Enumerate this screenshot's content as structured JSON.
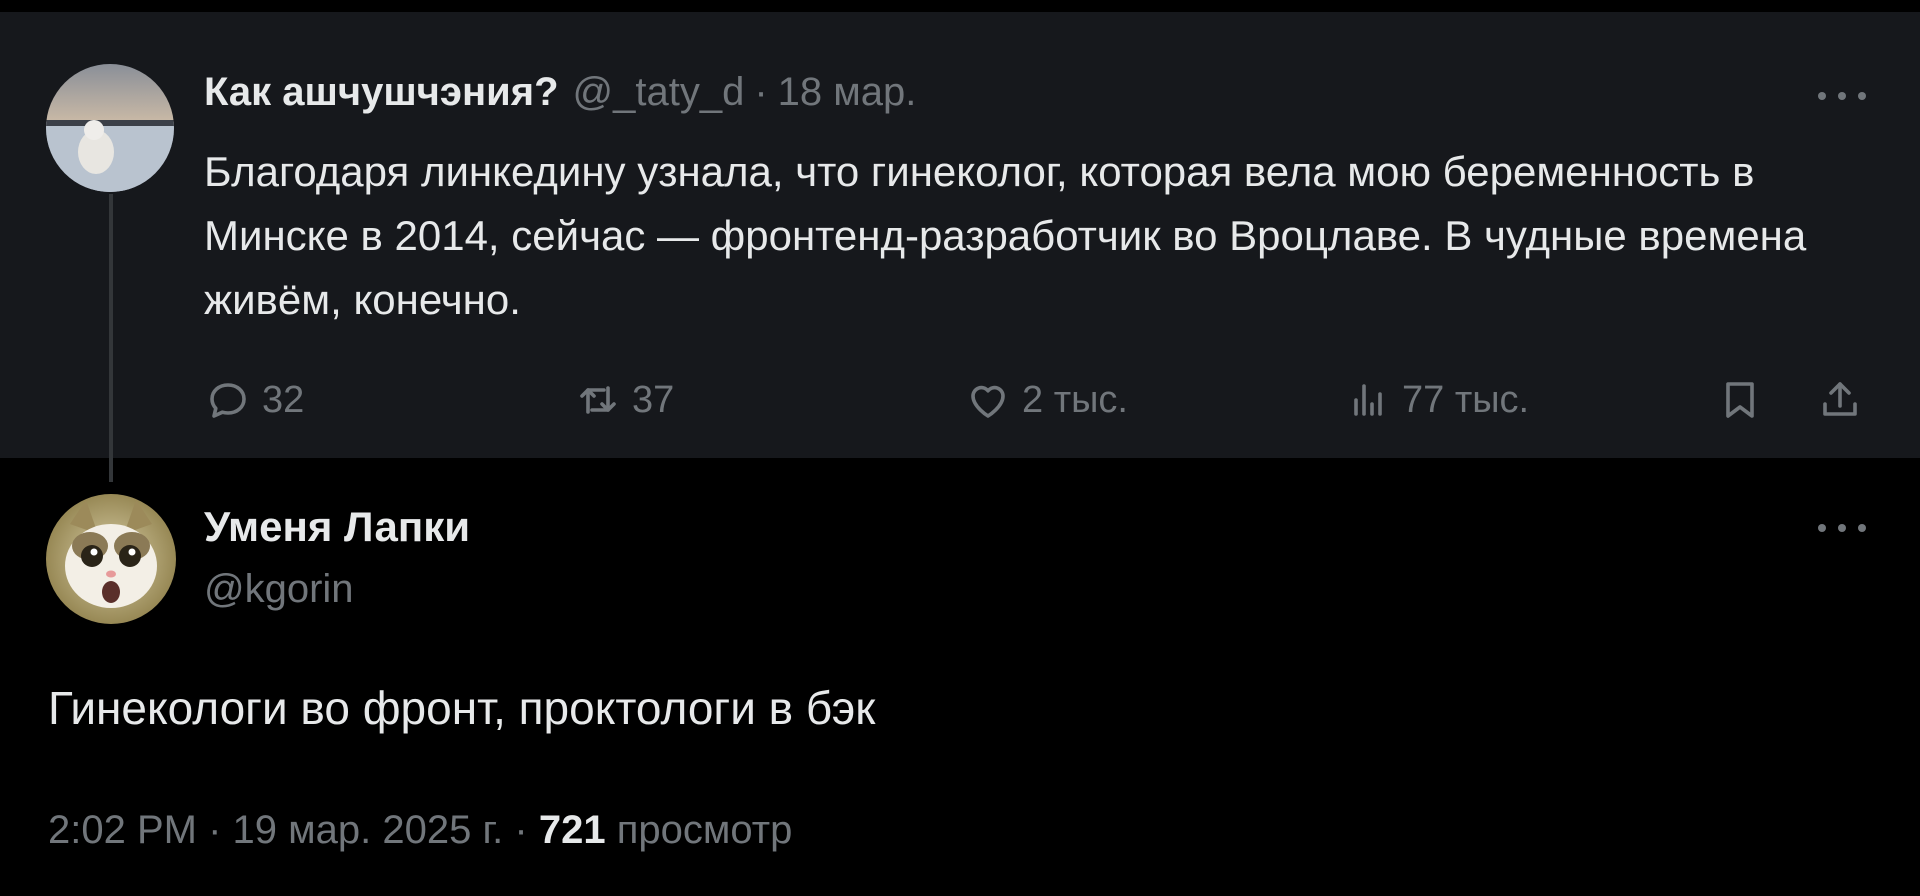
{
  "parent_tweet": {
    "display_name": "Как ашчушчэния?",
    "handle": "@_taty_d",
    "separator": "·",
    "date": "18 мар.",
    "text": "Благодаря линкедину узнала, что гинеколог, которая вела мою беременность в Минске в 2014, сейчас — фронтенд-разработчик во Вроцлаве. В чудные времена живём, конечно.",
    "actions": {
      "replies": "32",
      "reposts": "37",
      "likes": "2 тыс.",
      "views": "77 тыс."
    },
    "icons": [
      "reply-icon",
      "repost-icon",
      "like-icon",
      "views-icon",
      "bookmark-icon",
      "share-icon",
      "more-icon"
    ]
  },
  "main_tweet": {
    "display_name": "Уменя Лапки",
    "handle": "@kgorin",
    "text": "Гинекологи во фронт, проктологи в бэк",
    "meta": {
      "time": "2:02 PM",
      "separator": "·",
      "date": "19 мар. 2025 г.",
      "views_count": "721",
      "views_label": "просмотр"
    },
    "icons": [
      "more-icon"
    ]
  },
  "colors": {
    "background": "#000000",
    "parent_background": "#16181c",
    "text_primary": "#e7e9ea",
    "text_secondary": "#71767b",
    "thread_line": "#333639"
  }
}
